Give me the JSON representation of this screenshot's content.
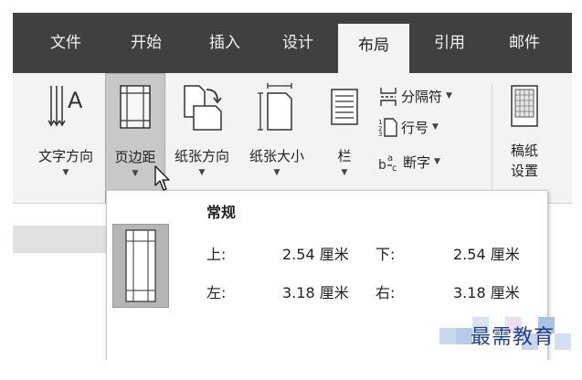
{
  "tabs": [
    {
      "label": "文件"
    },
    {
      "label": "开始"
    },
    {
      "label": "插入"
    },
    {
      "label": "设计"
    },
    {
      "label": "布局"
    },
    {
      "label": "引用"
    },
    {
      "label": "邮件"
    }
  ],
  "ribbon": {
    "text_direction": {
      "label": "文字方向",
      "glyph": "A"
    },
    "margins": {
      "label": "页边距"
    },
    "orientation": {
      "label": "纸张方向"
    },
    "size": {
      "label": "纸张大小"
    },
    "columns": {
      "label": "栏"
    },
    "breaks": {
      "label": "分隔符"
    },
    "line_numbers": {
      "label": "行号"
    },
    "hyphenation": {
      "label": "断字"
    },
    "manuscript": {
      "label": "稿纸\n设置"
    }
  },
  "margins_menu": {
    "option": {
      "name": "常规",
      "top_label": "上:",
      "top_value": "2.54 厘米",
      "bottom_label": "下:",
      "bottom_value": "2.54 厘米",
      "left_label": "左:",
      "left_value": "3.18 厘米",
      "right_label": "右:",
      "right_value": "3.18 厘米"
    }
  },
  "watermark": {
    "text": "最需教育"
  },
  "colors": {
    "tabbar": "#404040",
    "ribbon": "#f3f3f3",
    "selected": "#c8c8c8",
    "watermark": "#1f3f8f"
  }
}
